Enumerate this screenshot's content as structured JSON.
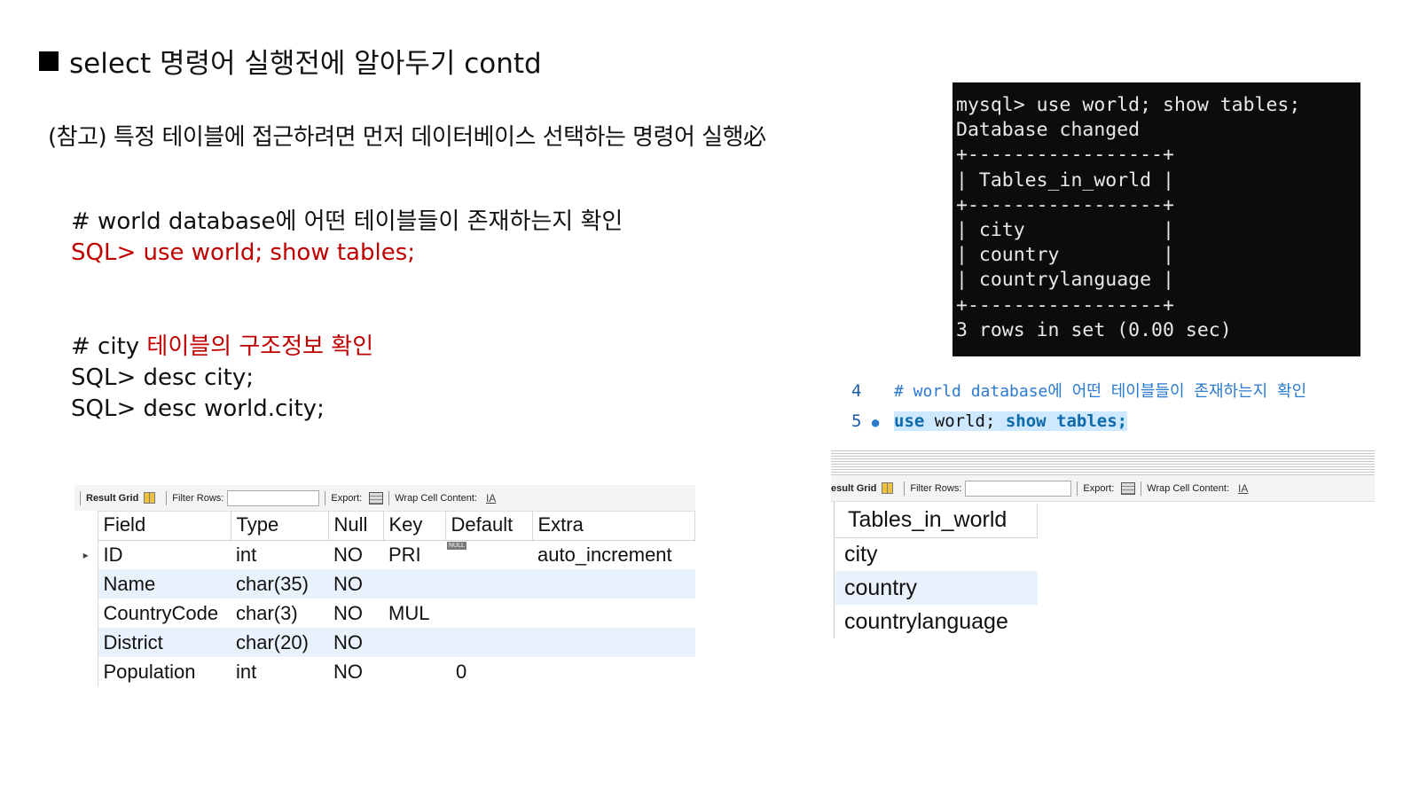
{
  "slide": {
    "title": "select 명령어 실행전에 알아두기 contd",
    "note": "(참고) 특정 테이블에 접근하려면 먼저 데이터베이스 선택하는 명령어 실행必",
    "block1": {
      "comment": "# world database에 어떤 테이블들이 존재하는지 확인",
      "sql": "SQL> use world; show tables;"
    },
    "block2": {
      "comment_prefix": "# city ",
      "comment_red": "테이블의 구조정보 확인",
      "sql1": "SQL> desc city;",
      "sql2": "SQL> desc world.city;"
    }
  },
  "terminal": {
    "lines": [
      "mysql> use world; show tables;",
      "Database changed",
      "+-----------------+",
      "| Tables_in_world |",
      "+-----------------+",
      "| city            |",
      "| country         |",
      "| countrylanguage |",
      "+-----------------+",
      "3 rows in set (0.00 sec)"
    ]
  },
  "editor": {
    "line4_num": "4",
    "line4_text": "# world database에 어떤 테이블들이 존재하는지 확인",
    "line5_num": "5",
    "line5_kw1": "use",
    "line5_plain": " world; ",
    "line5_kw2": "show tables;"
  },
  "desc_toolbar": {
    "result_grid": "Result Grid",
    "filter_rows": "Filter Rows:",
    "export": "Export:",
    "wrap": "Wrap Cell Content:",
    "wrap_icon": "IA"
  },
  "desc_table": {
    "headers": [
      "Field",
      "Type",
      "Null",
      "Key",
      "Default",
      "Extra"
    ],
    "rows": [
      [
        "ID",
        "int",
        "NO",
        "PRI",
        "",
        "auto_increment"
      ],
      [
        "Name",
        "char(35)",
        "NO",
        "",
        "",
        ""
      ],
      [
        "CountryCode",
        "char(3)",
        "NO",
        "MUL",
        "",
        ""
      ],
      [
        "District",
        "char(20)",
        "NO",
        "",
        "",
        ""
      ],
      [
        "Population",
        "int",
        "NO",
        "",
        "0",
        ""
      ]
    ],
    "null_badge": "NULL",
    "row_marker": "▸"
  },
  "tables_toolbar": {
    "result_grid": "esult Grid",
    "filter_rows": "Filter Rows:",
    "export": "Export:",
    "wrap": "Wrap Cell Content:",
    "wrap_icon": "IA"
  },
  "tables_table": {
    "header": "Tables_in_world",
    "rows": [
      "city",
      "country",
      "countrylanguage"
    ]
  }
}
